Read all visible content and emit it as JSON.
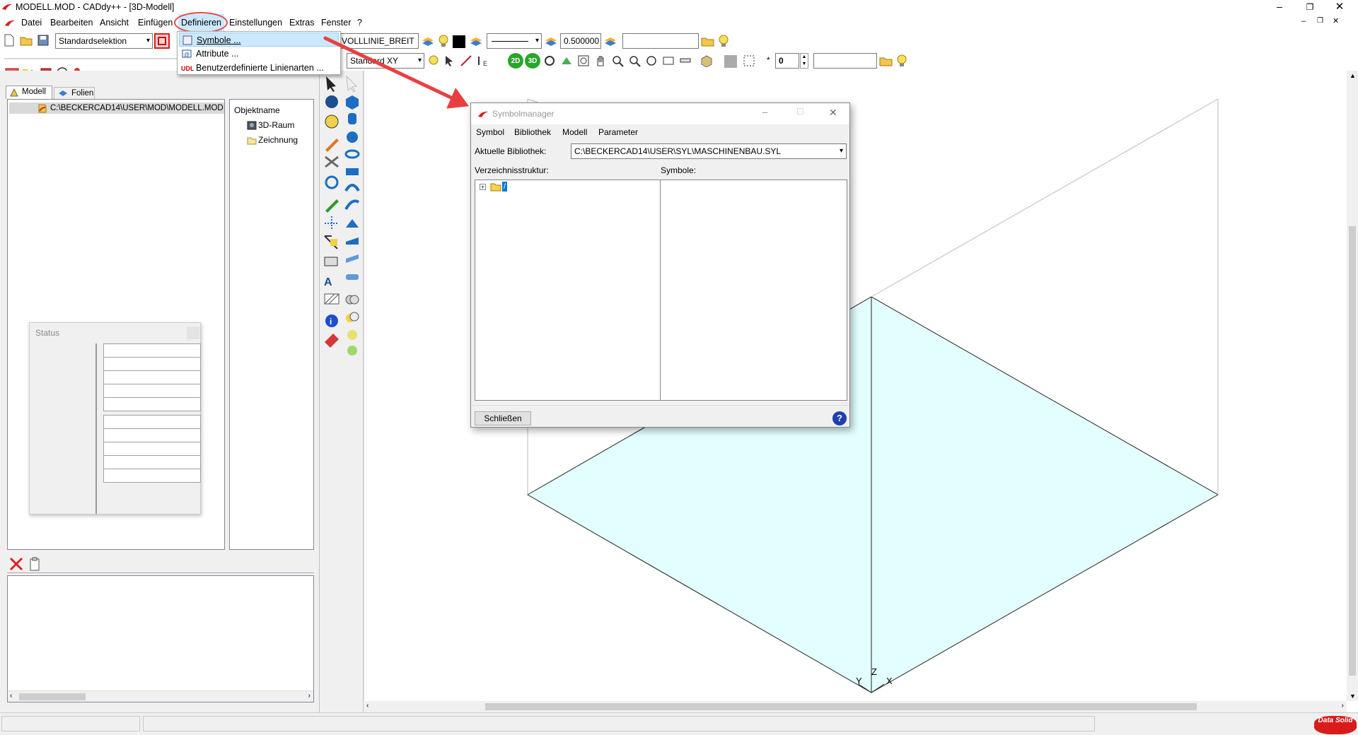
{
  "window": {
    "title": "MODELL.MOD  -  CADdy++ - [3D-Modell]"
  },
  "menubar": [
    "Datei",
    "Bearbeiten",
    "Ansicht",
    "Einfügen",
    "Definieren",
    "Einstellungen",
    "Extras",
    "Fenster",
    "?"
  ],
  "define_menu": {
    "items": [
      "Symbole ...",
      "Attribute ...",
      "Benutzerdefinierte Linienarten ..."
    ]
  },
  "toolbar": {
    "selection": "Standardselektion",
    "linetype": "VOLLLINIE_BREIT",
    "linewidth": "0.500000",
    "plane": "Standard XY",
    "number": "0",
    "btn_2d": "2D",
    "btn_3d": "3D"
  },
  "left_panel": {
    "tabs": [
      "Modell",
      "Folien"
    ],
    "tree_root": "C:\\BECKERCAD14\\USER\\MOD\\MODELL.MOD",
    "object_header": "Objektname",
    "objects": [
      "3D-Raum",
      "Zeichnung"
    ]
  },
  "status_window": {
    "title": "Status"
  },
  "dialog": {
    "title": "Symbolmanager",
    "menu": [
      "Symbol",
      "Bibliothek",
      "Modell",
      "Parameter"
    ],
    "library_label": "Aktuelle Bibliothek:",
    "library_value": "C:\\BECKERCAD14\\USER\\SYL\\MASCHINENBAU.SYL",
    "tree_label": "Verzeichnisstruktur:",
    "tree_root": "/",
    "symbols_label": "Symbole:",
    "close_button": "Schließen"
  },
  "axis": {
    "x": "X",
    "y": "Y",
    "z": "Z"
  },
  "logo": {
    "text": "Data Solid"
  },
  "colors": {
    "accent_red": "#e03b3b",
    "plane_fill": "#e2fefe",
    "highlight": "#cce8ff"
  }
}
